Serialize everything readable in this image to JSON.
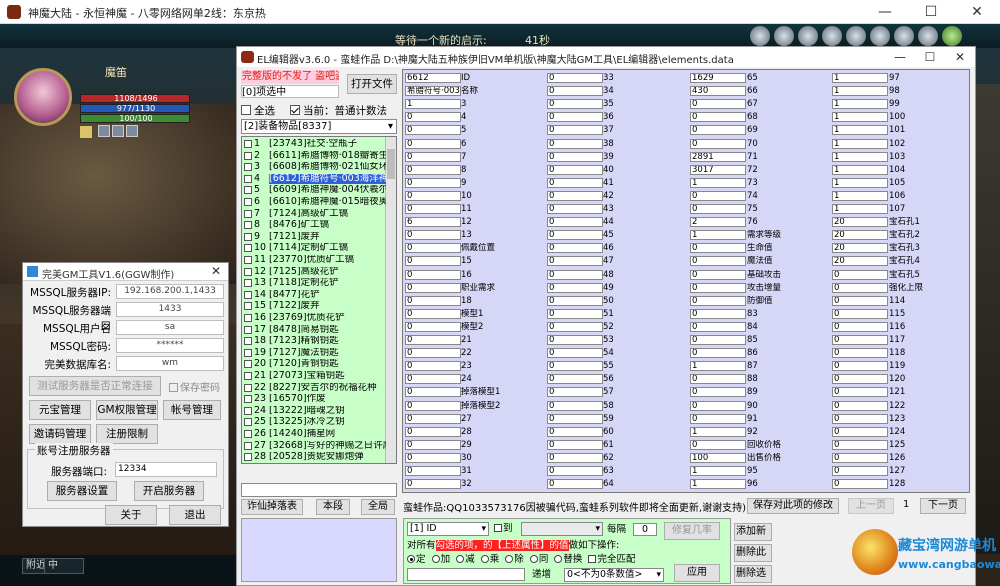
{
  "window": {
    "title": "神魔大陆 - 永恒神魔 - 八零网络网单2线：东京热",
    "minimize": "—",
    "maximize": "☐",
    "close": "✕"
  },
  "game": {
    "news": "等待一个新的启示:",
    "news_time": "41秒",
    "player": {
      "name": "魔笛",
      "hp": "1108/1496",
      "mp": "977/1130",
      "ep": "100/100"
    },
    "chat_tab": "附近",
    "chat_tab2": "中"
  },
  "gm_tool": {
    "title": "完美GM工具V1.6(GGW制作)",
    "close": "✕",
    "fields": [
      {
        "label": "MSSQL服务器IP:",
        "value": "192.168.200.1,1433"
      },
      {
        "label": "MSSQL服务器端口",
        "value": "1433"
      },
      {
        "label": "MSSQL用户名",
        "value": "sa"
      },
      {
        "label": "MSSQL密码:",
        "value": "******"
      },
      {
        "label": "完美数据库名:",
        "value": "wm"
      }
    ],
    "test_button": "测试服务器是否正常连接",
    "save_pwd": "保存密码",
    "buttons": [
      "元宝管理",
      "GM权限管理",
      "帐号管理",
      "邀请码管理",
      "注册限制"
    ],
    "group_title": "账号注册服务器",
    "port_label": "服务器端口:",
    "port_value": "12334",
    "server_settings": "服务器设置",
    "start_server": "开启服务器",
    "about": "关于",
    "exit": "退出"
  },
  "el_editor": {
    "title": "EL编辑器v3.6.0  -  蛮蛙作品  D:\\神魔大陆五种族伊旧VM单机版\\神魔大陆GM工具\\EL编辑器\\elements.data",
    "hack_label": "完整版的不发了 盗吧盗",
    "selected_info": "[0]项选中",
    "open_file": "打开文件",
    "select_all": "全选",
    "current_label": "当前：普通计数法",
    "category": "[2]装备物品[8337]",
    "items": [
      {
        "no": "1",
        "text": "[23743]社交·空瓶子"
      },
      {
        "no": "2",
        "text": "[6611]希腊博物·018瓣寄生·黄"
      },
      {
        "no": "3",
        "text": "[6608]希腊博物·021仙女环·火"
      },
      {
        "no": "4",
        "text": "[6612]希腊符号·003海洋神文"
      },
      {
        "no": "5",
        "text": "[6609]希腊神魔·004伏羲尔·冲"
      },
      {
        "no": "6",
        "text": "[6610]希腊神魔·015暗夜奥旅"
      },
      {
        "no": "7",
        "text": "[7124]高级矿工镐"
      },
      {
        "no": "8",
        "text": "[8476]矿工镐"
      },
      {
        "no": "9",
        "text": "[7121]废弃"
      },
      {
        "no": "10",
        "text": "[7114]定制矿工镐"
      },
      {
        "no": "11",
        "text": "[23770]优质矿工镐"
      },
      {
        "no": "12",
        "text": "[7125]高级花铲"
      },
      {
        "no": "13",
        "text": "[7118]定制花铲"
      },
      {
        "no": "14",
        "text": "[8477]花铲"
      },
      {
        "no": "15",
        "text": "[7122]废弃"
      },
      {
        "no": "16",
        "text": "[23769]优质花铲"
      },
      {
        "no": "17",
        "text": "[8478]简易钥匙"
      },
      {
        "no": "18",
        "text": "[7123]精钢钥匙"
      },
      {
        "no": "19",
        "text": "[7127]魔法钥匙"
      },
      {
        "no": "20",
        "text": "[7120]青铜钥匙"
      },
      {
        "no": "21",
        "text": "[27073]宝箱钥匙"
      },
      {
        "no": "22",
        "text": "[8227]安吉尔的祝福花种"
      },
      {
        "no": "23",
        "text": "[16570]作废"
      },
      {
        "no": "24",
        "text": "[13222]暗魂之钥"
      },
      {
        "no": "25",
        "text": "[13225]冰冷之钥"
      },
      {
        "no": "26",
        "text": "[14240]捕星网"
      },
      {
        "no": "27",
        "text": "[32668]写好的神赐之日许愿"
      },
      {
        "no": "28",
        "text": "[20528]贵妮安娜炮弹"
      }
    ],
    "left_buttons": [
      "诈仙掉落表",
      "本段",
      "全局"
    ],
    "grid_col1": [
      {
        "v": "6612",
        "l": "ID"
      },
      {
        "v": "希腊符号·003",
        "l": "名称"
      },
      {
        "v": "1",
        "l": "3"
      },
      {
        "v": "0",
        "l": "4"
      },
      {
        "v": "0",
        "l": "5"
      },
      {
        "v": "0",
        "l": "6"
      },
      {
        "v": "0",
        "l": "7"
      },
      {
        "v": "0",
        "l": "8"
      },
      {
        "v": "0",
        "l": "9"
      },
      {
        "v": "0",
        "l": "10"
      },
      {
        "v": "0",
        "l": "11"
      },
      {
        "v": "6",
        "l": "12"
      },
      {
        "v": "0",
        "l": "13"
      },
      {
        "v": "0",
        "l": "佩戴位置"
      },
      {
        "v": "0",
        "l": "15"
      },
      {
        "v": "0",
        "l": "16"
      },
      {
        "v": "0",
        "l": "职业需求"
      },
      {
        "v": "0",
        "l": "18"
      },
      {
        "v": "0",
        "l": "模型1"
      },
      {
        "v": "0",
        "l": "模型2"
      },
      {
        "v": "0",
        "l": "21"
      },
      {
        "v": "0",
        "l": "22"
      },
      {
        "v": "0",
        "l": "23"
      },
      {
        "v": "0",
        "l": "24"
      },
      {
        "v": "0",
        "l": "掉落模型1"
      },
      {
        "v": "0",
        "l": "掉落模型2"
      },
      {
        "v": "0",
        "l": "27"
      },
      {
        "v": "0",
        "l": "28"
      },
      {
        "v": "0",
        "l": "29"
      },
      {
        "v": "0",
        "l": "30"
      },
      {
        "v": "0",
        "l": "31"
      },
      {
        "v": "0",
        "l": "32"
      }
    ],
    "grid_col2": [
      {
        "v": "0",
        "l": "33"
      },
      {
        "v": "0",
        "l": "34"
      },
      {
        "v": "0",
        "l": "35"
      },
      {
        "v": "0",
        "l": "36"
      },
      {
        "v": "0",
        "l": "37"
      },
      {
        "v": "0",
        "l": "38"
      },
      {
        "v": "0",
        "l": "39"
      },
      {
        "v": "0",
        "l": "40"
      },
      {
        "v": "0",
        "l": "41"
      },
      {
        "v": "0",
        "l": "42"
      },
      {
        "v": "0",
        "l": "43"
      },
      {
        "v": "0",
        "l": "44"
      },
      {
        "v": "0",
        "l": "45"
      },
      {
        "v": "0",
        "l": "46"
      },
      {
        "v": "0",
        "l": "47"
      },
      {
        "v": "0",
        "l": "48"
      },
      {
        "v": "0",
        "l": "49"
      },
      {
        "v": "0",
        "l": "50"
      },
      {
        "v": "0",
        "l": "51"
      },
      {
        "v": "0",
        "l": "52"
      },
      {
        "v": "0",
        "l": "53"
      },
      {
        "v": "0",
        "l": "54"
      },
      {
        "v": "0",
        "l": "55"
      },
      {
        "v": "0",
        "l": "56"
      },
      {
        "v": "0",
        "l": "57"
      },
      {
        "v": "0",
        "l": "58"
      },
      {
        "v": "0",
        "l": "59"
      },
      {
        "v": "0",
        "l": "60"
      },
      {
        "v": "0",
        "l": "61"
      },
      {
        "v": "0",
        "l": "62"
      },
      {
        "v": "0",
        "l": "63"
      },
      {
        "v": "0",
        "l": "64"
      }
    ],
    "grid_col3": [
      {
        "v": "1629",
        "l": "65"
      },
      {
        "v": "430",
        "l": "66"
      },
      {
        "v": "0",
        "l": "67"
      },
      {
        "v": "0",
        "l": "68"
      },
      {
        "v": "0",
        "l": "69"
      },
      {
        "v": "0",
        "l": "70"
      },
      {
        "v": "2891",
        "l": "71"
      },
      {
        "v": "3017",
        "l": "72"
      },
      {
        "v": "1",
        "l": "73"
      },
      {
        "v": "0",
        "l": "74"
      },
      {
        "v": "0",
        "l": "75"
      },
      {
        "v": "2",
        "l": "76"
      },
      {
        "v": "1",
        "l": "需求等级"
      },
      {
        "v": "0",
        "l": "生命值"
      },
      {
        "v": "0",
        "l": "魔法值"
      },
      {
        "v": "0",
        "l": "基础攻击"
      },
      {
        "v": "0",
        "l": "攻击增量"
      },
      {
        "v": "0",
        "l": "防御值"
      },
      {
        "v": "0",
        "l": "83"
      },
      {
        "v": "0",
        "l": "84"
      },
      {
        "v": "0",
        "l": "85"
      },
      {
        "v": "0",
        "l": "86"
      },
      {
        "v": "1",
        "l": "87"
      },
      {
        "v": "0",
        "l": "88"
      },
      {
        "v": "0",
        "l": "89"
      },
      {
        "v": "0",
        "l": "90"
      },
      {
        "v": "0",
        "l": "91"
      },
      {
        "v": "1",
        "l": "92"
      },
      {
        "v": "0",
        "l": "回收价格"
      },
      {
        "v": "100",
        "l": "出售价格"
      },
      {
        "v": "1",
        "l": "95"
      },
      {
        "v": "1",
        "l": "96"
      }
    ],
    "grid_col4": [
      {
        "v": "1",
        "l": "97"
      },
      {
        "v": "1",
        "l": "98"
      },
      {
        "v": "1",
        "l": "99"
      },
      {
        "v": "1",
        "l": "100"
      },
      {
        "v": "1",
        "l": "101"
      },
      {
        "v": "1",
        "l": "102"
      },
      {
        "v": "1",
        "l": "103"
      },
      {
        "v": "1",
        "l": "104"
      },
      {
        "v": "1",
        "l": "105"
      },
      {
        "v": "1",
        "l": "106"
      },
      {
        "v": "1",
        "l": "107"
      },
      {
        "v": "20",
        "l": "宝石孔1"
      },
      {
        "v": "20",
        "l": "宝石孔2"
      },
      {
        "v": "20",
        "l": "宝石孔3"
      },
      {
        "v": "20",
        "l": "宝石孔4"
      },
      {
        "v": "0",
        "l": "宝石孔5"
      },
      {
        "v": "0",
        "l": "强化上限"
      },
      {
        "v": "0",
        "l": "114"
      },
      {
        "v": "0",
        "l": "115"
      },
      {
        "v": "0",
        "l": "116"
      },
      {
        "v": "0",
        "l": "117"
      },
      {
        "v": "0",
        "l": "118"
      },
      {
        "v": "0",
        "l": "119"
      },
      {
        "v": "0",
        "l": "120"
      },
      {
        "v": "0",
        "l": "121"
      },
      {
        "v": "0",
        "l": "122"
      },
      {
        "v": "0",
        "l": "123"
      },
      {
        "v": "0",
        "l": "124"
      },
      {
        "v": "0",
        "l": "125"
      },
      {
        "v": "0",
        "l": "126"
      },
      {
        "v": "0",
        "l": "127"
      },
      {
        "v": "0",
        "l": "128"
      }
    ],
    "credit": "蛮蛙作品:QQ1033573176因被骗代码,蛮蛙系列软件即将全面更新,谢谢支持)",
    "save_button": "保存对此项的修改",
    "prev_page": "上一页",
    "page_number": "1",
    "next_page": "下一页",
    "batch": {
      "field_select": "[1] ID",
      "to_label": "到",
      "every_label": "每隔",
      "every_value": "0",
      "fix_button": "修复几率",
      "all_label": "对所有",
      "red_text": "勾选的项，的【上述属性】的值",
      "do_label": "做如下操作:",
      "ops": [
        "定",
        "加",
        "减",
        "乘",
        "除",
        "同",
        "替换"
      ],
      "exact_match": "完全匹配",
      "increment_label": "递增",
      "mode_select": "0<不为0条数值>",
      "apply_button": "应用"
    },
    "side_buttons": [
      "添加新",
      "删除此",
      "删除选"
    ]
  },
  "watermark": {
    "line1": "藏宝湾网游单机",
    "line2": "www.cangbaowan.net"
  }
}
